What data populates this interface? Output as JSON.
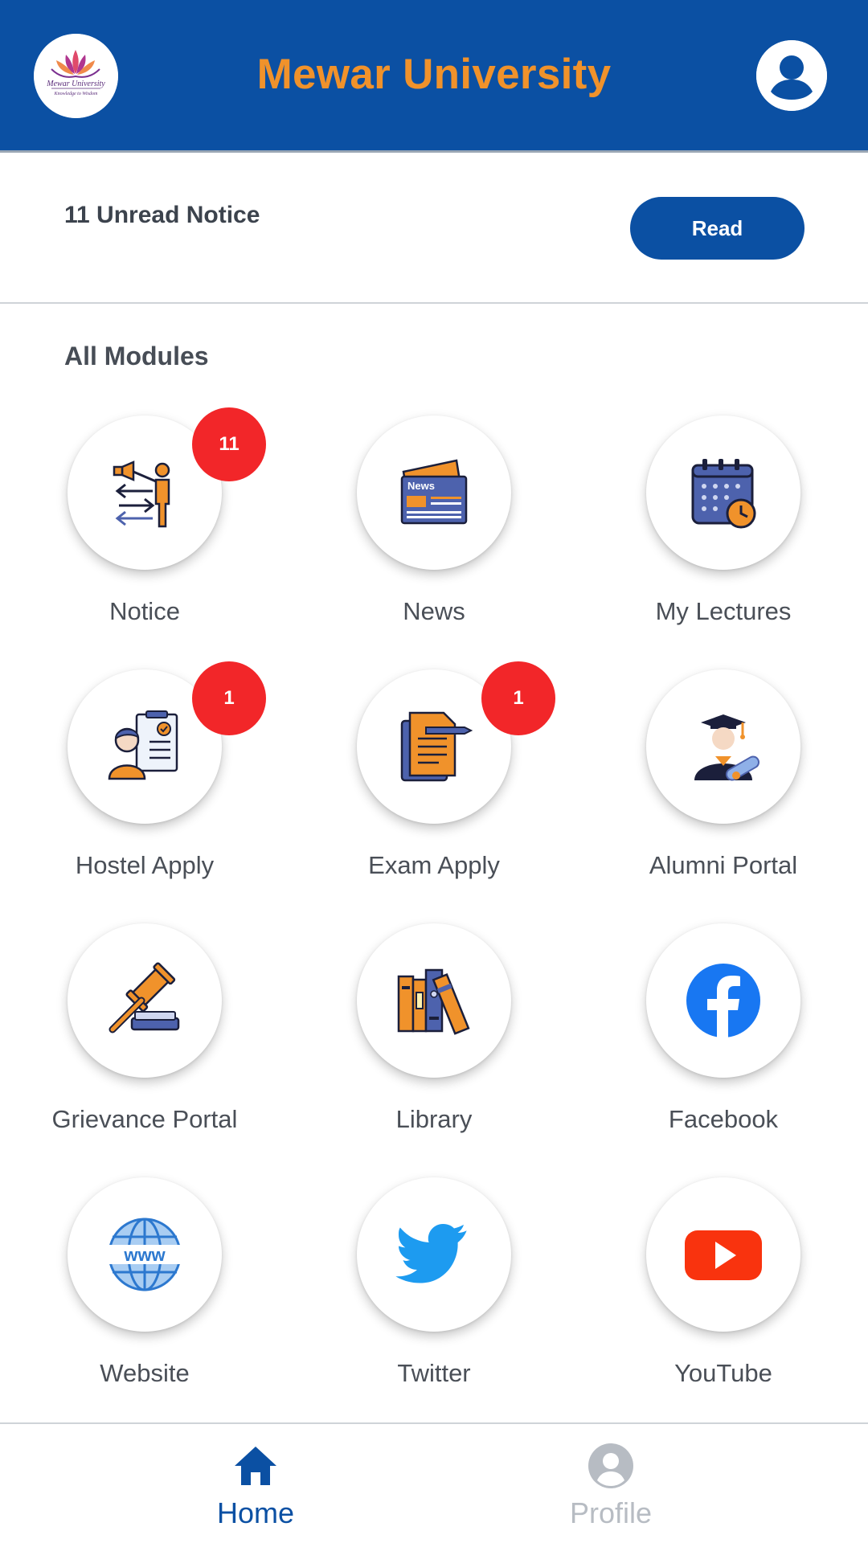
{
  "header": {
    "title": "Mewar University",
    "logo_text": "Mewar University",
    "logo_tagline": "Knowledge to Wisdom",
    "logo_icon": "lotus-logo",
    "account_icon": "account-circle-icon"
  },
  "notice_bar": {
    "text": "11 Unread Notice",
    "button_label": "Read"
  },
  "modules": {
    "section_title": "All Modules",
    "items": [
      {
        "label": "Notice",
        "badge": "11",
        "icon": "notice-megaphone-icon"
      },
      {
        "label": "News",
        "badge": "",
        "icon": "news-icon"
      },
      {
        "label": "My Lectures",
        "badge": "",
        "icon": "calendar-clock-icon"
      },
      {
        "label": "Hostel Apply",
        "badge": "1",
        "icon": "application-form-icon"
      },
      {
        "label": "Exam Apply",
        "badge": "1",
        "icon": "exam-document-icon"
      },
      {
        "label": "Alumni Portal",
        "badge": "",
        "icon": "graduate-icon"
      },
      {
        "label": "Grievance Portal",
        "badge": "",
        "icon": "gavel-icon"
      },
      {
        "label": "Library",
        "badge": "",
        "icon": "books-icon"
      },
      {
        "label": "Facebook",
        "badge": "",
        "icon": "facebook-icon"
      },
      {
        "label": "Website",
        "badge": "",
        "icon": "globe-www-icon"
      },
      {
        "label": "Twitter",
        "badge": "",
        "icon": "twitter-icon"
      },
      {
        "label": "YouTube",
        "badge": "",
        "icon": "youtube-icon"
      }
    ]
  },
  "bottom_nav": {
    "home_label": "Home",
    "profile_label": "Profile",
    "active": "Home"
  },
  "colors": {
    "primary": "#0b50a3",
    "accent": "#f0922b",
    "badge": "#f22629",
    "label_text": "#4a4f57"
  }
}
